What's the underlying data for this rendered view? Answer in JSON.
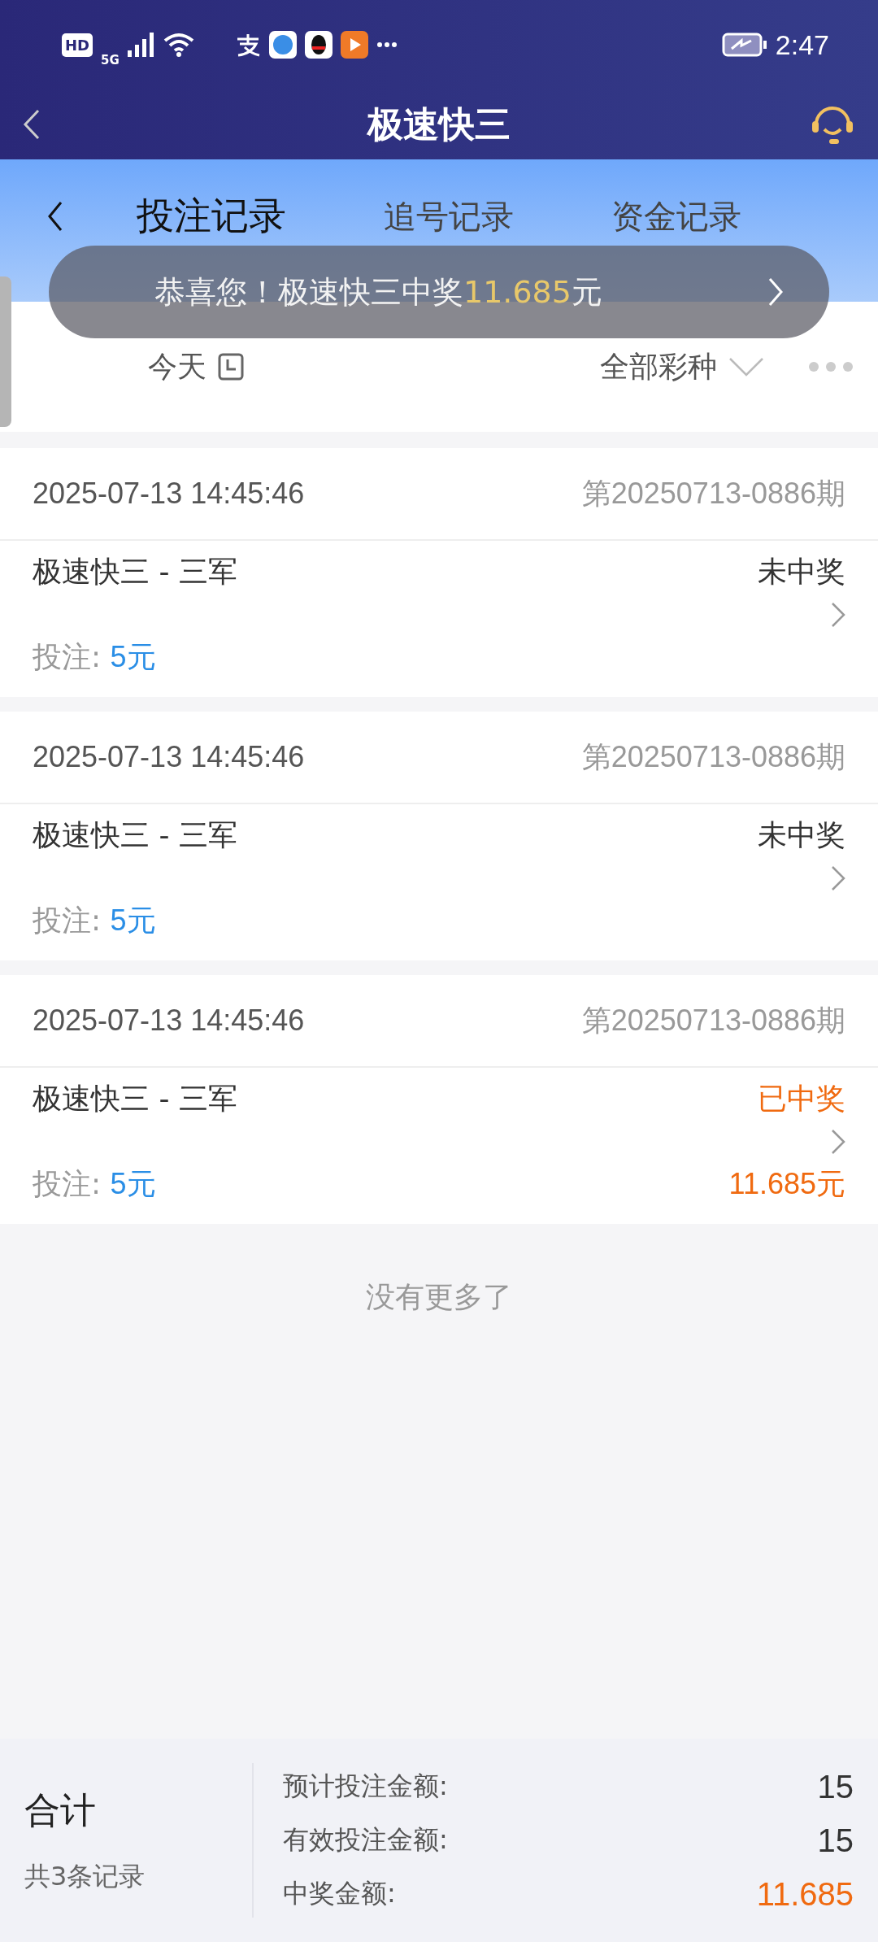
{
  "status_bar": {
    "time": "2:47",
    "network": "5G",
    "hd": "HD"
  },
  "header": {
    "title": "极速快三"
  },
  "tabs": [
    {
      "label": "投注记录",
      "selected": true
    },
    {
      "label": "追号记录",
      "selected": false
    },
    {
      "label": "资金记录",
      "selected": false
    }
  ],
  "toast": {
    "text_before": "恭喜您！极速快三中奖",
    "amount": "11.685",
    "text_after": "元"
  },
  "filters": {
    "date": "今天",
    "lottery": "全部彩种"
  },
  "records": [
    {
      "time": "2025-07-13 14:45:46",
      "issue": "第20250713-0886期",
      "game": "极速快三 - 三军",
      "status": "未中奖",
      "won": false,
      "bet_label": "投注:",
      "bet": "5元"
    },
    {
      "time": "2025-07-13 14:45:46",
      "issue": "第20250713-0886期",
      "game": "极速快三 - 三军",
      "status": "未中奖",
      "won": false,
      "bet_label": "投注:",
      "bet": "5元"
    },
    {
      "time": "2025-07-13 14:45:46",
      "issue": "第20250713-0886期",
      "game": "极速快三 - 三军",
      "status": "已中奖",
      "won": true,
      "bet_label": "投注:",
      "bet": "5元",
      "prize": "11.685元"
    }
  ],
  "end_text": "没有更多了",
  "summary": {
    "title": "合计",
    "count": "共3条记录",
    "rows": [
      {
        "label": "预计投注金额:",
        "value": "15",
        "highlight": false
      },
      {
        "label": "有效投注金额:",
        "value": "15",
        "highlight": false
      },
      {
        "label": "中奖金额:",
        "value": "11.685",
        "highlight": true
      }
    ]
  }
}
